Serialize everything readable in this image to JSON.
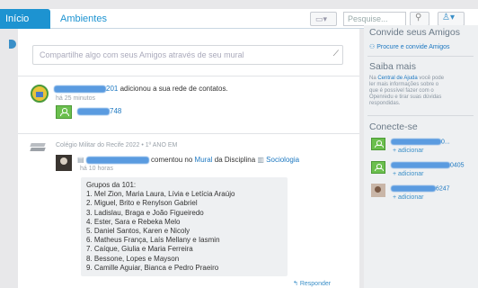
{
  "topbar": {
    "tab_inicio": "Início",
    "tab_ambientes": "Ambientes",
    "search_placeholder": "Pesquise..."
  },
  "main": {
    "compose_placeholder": "Compartilhe algo com seus Amigos através de seu mural",
    "activity1": {
      "name_suffix": "201",
      "action": "adicionou a sua rede de contatos.",
      "time": "há 25 minutos",
      "contact_suffix": "748"
    },
    "activity2": {
      "group": "Colégio Militar do Recife 2022 • 1º ANO EM",
      "action": "comentou no",
      "mural": "Mural",
      "da_disciplina": "da Disciplina",
      "discipline": "Sociologia",
      "time": "há 10 horas",
      "post_lines": [
        "Grupos da 101:",
        "1. Mel Zion, Maria Laura, Lívia e Letícia Araújo",
        "2. Miguel, Brito e Renylson Gabriel",
        "3. Ladislau, Braga e João Figueiredo",
        "4. Ester, Sara e Rebeka Melo",
        "5. Daniel Santos, Karen e Nicoly",
        "6. Matheus França, Laís Mellany e Iasmin",
        "7. Caíque, Giulia e Maria Ferreira",
        "8. Bessone, Lopes e Mayson",
        "9. Camille Aguiar, Bianca e Pedro Praeiro"
      ],
      "reply": "Responder"
    }
  },
  "sidebar": {
    "invite_title": "Convide seus Amigos",
    "invite_link": "Procure e convide Amigos",
    "know_title": "Saiba mais",
    "know_text_pre": "Na",
    "know_link": "Central de Ajuda",
    "know_text_post": "você pode ler mais informações sobre o que é possível fazer com o Openredu e tirar suas dúvidas respondidas.",
    "connect_title": "Conecte-se",
    "connect_items": [
      {
        "suffix": "0...",
        "add": "+ adicionar"
      },
      {
        "suffix": "0405",
        "add": "+ adicionar"
      },
      {
        "suffix": "6247",
        "add": "+ adicionar"
      }
    ]
  },
  "colors": {
    "accent": "#1d93d1",
    "link": "#1d78c1",
    "avatar_green": "#6bbf4e"
  }
}
